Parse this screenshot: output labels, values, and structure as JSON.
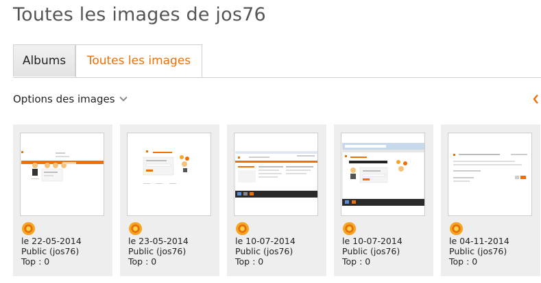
{
  "page": {
    "title": "Toutes les images de jos76"
  },
  "tabs": [
    {
      "label": "Albums",
      "active": false
    },
    {
      "label": "Toutes les images",
      "active": true
    }
  ],
  "options": {
    "label": "Options des images"
  },
  "colors": {
    "accent": "#f16e00",
    "badge": "#f5a623",
    "card_bg": "#eeeeee"
  },
  "images": [
    {
      "date": "le 22-05-2014",
      "visibility": "Public (jos76)",
      "top": "Top : 0",
      "badge_icon": "sun-badge-icon"
    },
    {
      "date": "le 23-05-2014",
      "visibility": "Public (jos76)",
      "top": "Top : 0",
      "badge_icon": "sun-badge-icon"
    },
    {
      "date": "le 10-07-2014",
      "visibility": "Public (jos76)",
      "top": "Top : 0",
      "badge_icon": "sun-badge-icon"
    },
    {
      "date": "le 10-07-2014",
      "visibility": "Public (jos76)",
      "top": "Top : 0",
      "badge_icon": "sun-badge-icon"
    },
    {
      "date": "le 04-11-2014",
      "visibility": "Public (jos76)",
      "top": "Top : 0",
      "badge_icon": "sun-badge-icon"
    }
  ]
}
